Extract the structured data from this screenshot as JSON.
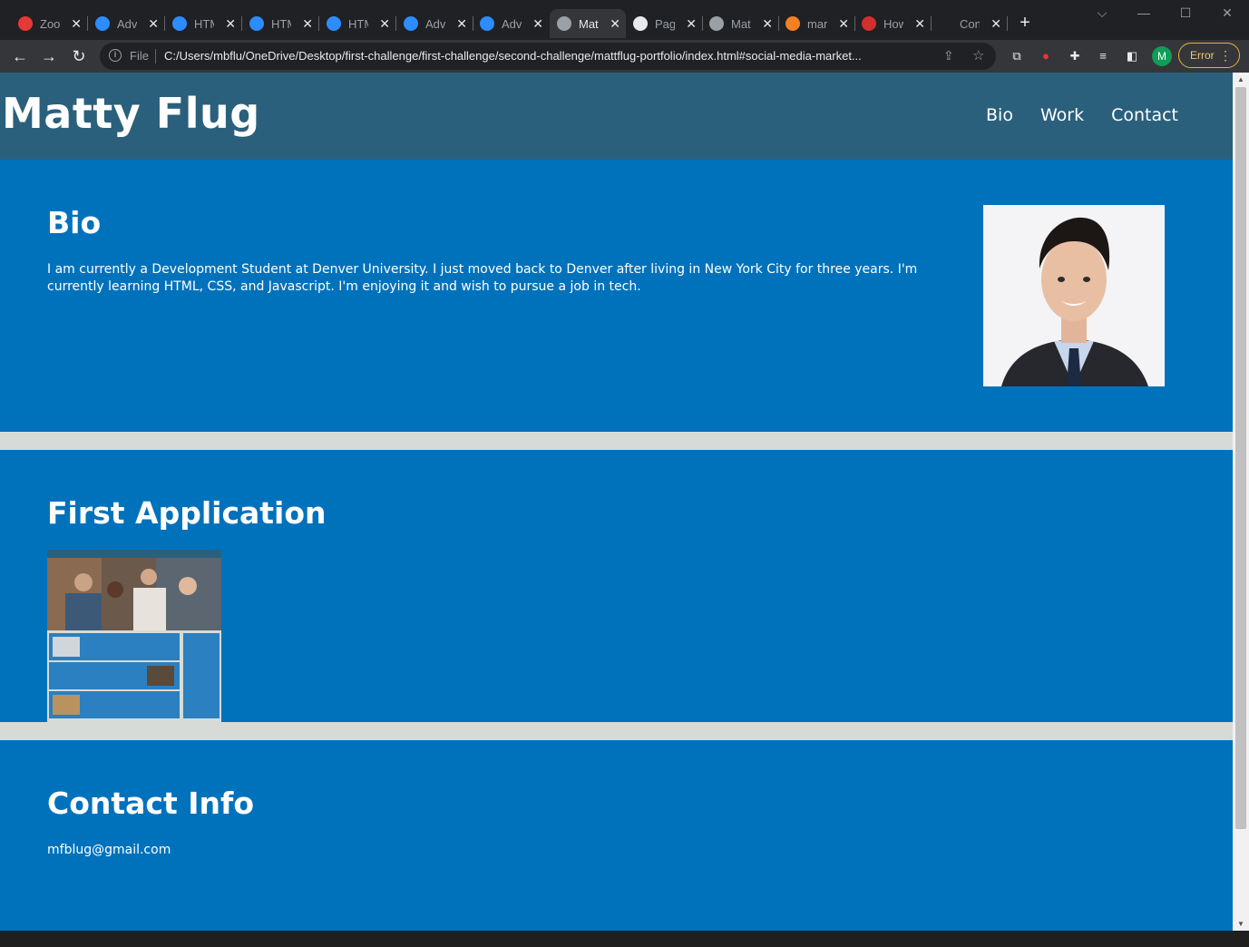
{
  "browser": {
    "tabs": [
      {
        "title": "Zoo",
        "fav_color": "#e53935",
        "close": "✕"
      },
      {
        "title": "Adv",
        "fav_color": "#2d8cff",
        "close": "✕"
      },
      {
        "title": "HTM",
        "fav_color": "#2d8cff",
        "close": "✕"
      },
      {
        "title": "HTM",
        "fav_color": "#2d8cff",
        "close": "✕"
      },
      {
        "title": "HTM",
        "fav_color": "#2d8cff",
        "close": "✕"
      },
      {
        "title": "Adv",
        "fav_color": "#2d8cff",
        "close": "✕"
      },
      {
        "title": "Adv",
        "fav_color": "#2d8cff",
        "close": "✕"
      },
      {
        "title": "Mat",
        "fav_color": "#9aa0a6",
        "close": "✕"
      },
      {
        "title": "Pag",
        "fav_color": "#e8eaed",
        "close": "✕"
      },
      {
        "title": "Mat",
        "fav_color": "#9aa0a6",
        "close": "✕"
      },
      {
        "title": "mar",
        "fav_color": "#f48024",
        "close": "✕"
      },
      {
        "title": "How",
        "fav_color": "#d32f2f",
        "close": "✕"
      },
      {
        "title": "Con",
        "fav_color": "#202124",
        "close": "✕"
      }
    ],
    "active_tab_index": 7,
    "new_tab": "+",
    "address": {
      "scheme": "File",
      "url": "C:/Users/mbflu/OneDrive/Desktop/first-challenge/first-challenge/second-challenge/mattflug-portfolio/index.html#social-media-market..."
    },
    "profile_initial": "M",
    "error_label": "Error"
  },
  "page": {
    "header": {
      "title": "Matty Flug",
      "nav": [
        "Bio",
        "Work",
        "Contact"
      ]
    },
    "bio": {
      "heading": "Bio",
      "text": "I am currently a Development Student at Denver University. I just moved back to Denver after living in New York City for three years. I'm currently learning HTML, CSS, and Javascript. I'm enjoying it and wish to pursue a job in tech."
    },
    "work": {
      "heading": "First Application"
    },
    "contact": {
      "heading": "Contact Info",
      "email": "mfblug@gmail.com"
    }
  },
  "colors": {
    "header_bg": "#2a607c",
    "section_bg": "#0072bc",
    "gap_bg": "#d7dbd8"
  }
}
